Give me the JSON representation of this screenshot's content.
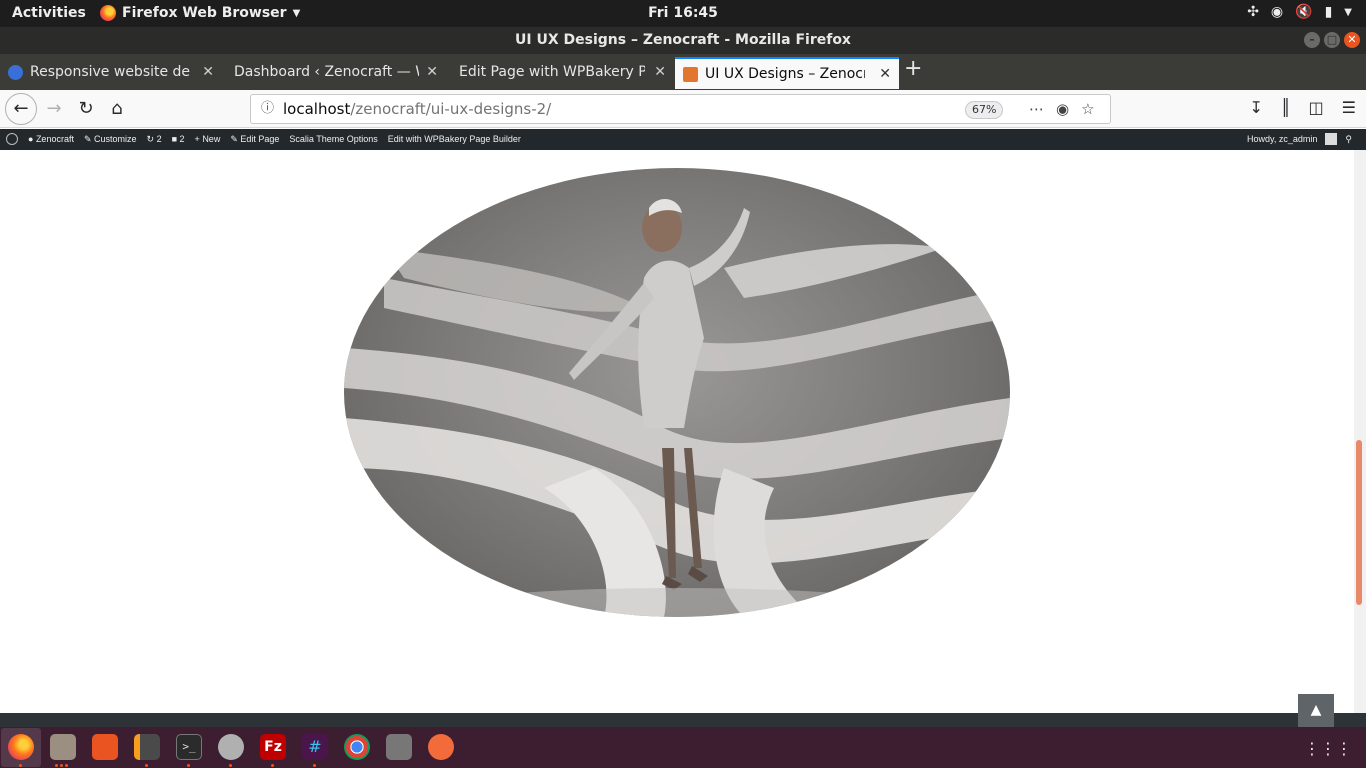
{
  "topbar": {
    "activities": "Activities",
    "app_name": "Firefox Web Browser",
    "clock": "Fri 16:45",
    "tray_icons": [
      "slack-icon",
      "wifi-icon",
      "volume-muted-icon",
      "battery-icon",
      "system-menu-icon"
    ]
  },
  "window": {
    "title": "UI UX Designs – Zenocraft - Mozilla Firefox"
  },
  "tabs": [
    {
      "label": "Responsive website desi",
      "icon": "site-icon",
      "active": false
    },
    {
      "label": "Dashboard ‹ Zenocraft — W",
      "icon": "",
      "active": false
    },
    {
      "label": "Edit Page with WPBakery Pa",
      "icon": "",
      "active": false
    },
    {
      "label": "UI UX Designs – Zenocraf",
      "icon": "zenocraft-icon",
      "active": true
    }
  ],
  "navbar": {
    "url_host": "localhost",
    "url_path": "/zenocraft/ui-ux-designs-2/",
    "zoom": "67%"
  },
  "wpbar": {
    "site_name": "Zenocraft",
    "customize": "Customize",
    "updates_count": "2",
    "comments_count": "2",
    "new": "New",
    "edit_page": "Edit Page",
    "theme_options": "Scalia Theme Options",
    "wpbakery": "Edit with WPBakery Page Builder",
    "howdy": "Howdy, zc_admin"
  },
  "content": {
    "hero_image": "woman-paper-dress-photo",
    "back_to_top": "▲"
  },
  "dock": {
    "apps": [
      "firefox-icon",
      "files-icon",
      "software-center-icon",
      "sublime-text-icon",
      "terminal-icon",
      "settings-tool-icon",
      "filezilla-icon",
      "slack-icon",
      "chrome-icon",
      "camera-icon",
      "postman-icon"
    ],
    "colors": [
      "#e66000",
      "#9a8f80",
      "#e95420",
      "#4a4a4a",
      "#2b2b2b",
      "#b0b0b0",
      "#bf0000",
      "#4a154b",
      "#4285f4",
      "#777777",
      "#f26b3a"
    ]
  }
}
